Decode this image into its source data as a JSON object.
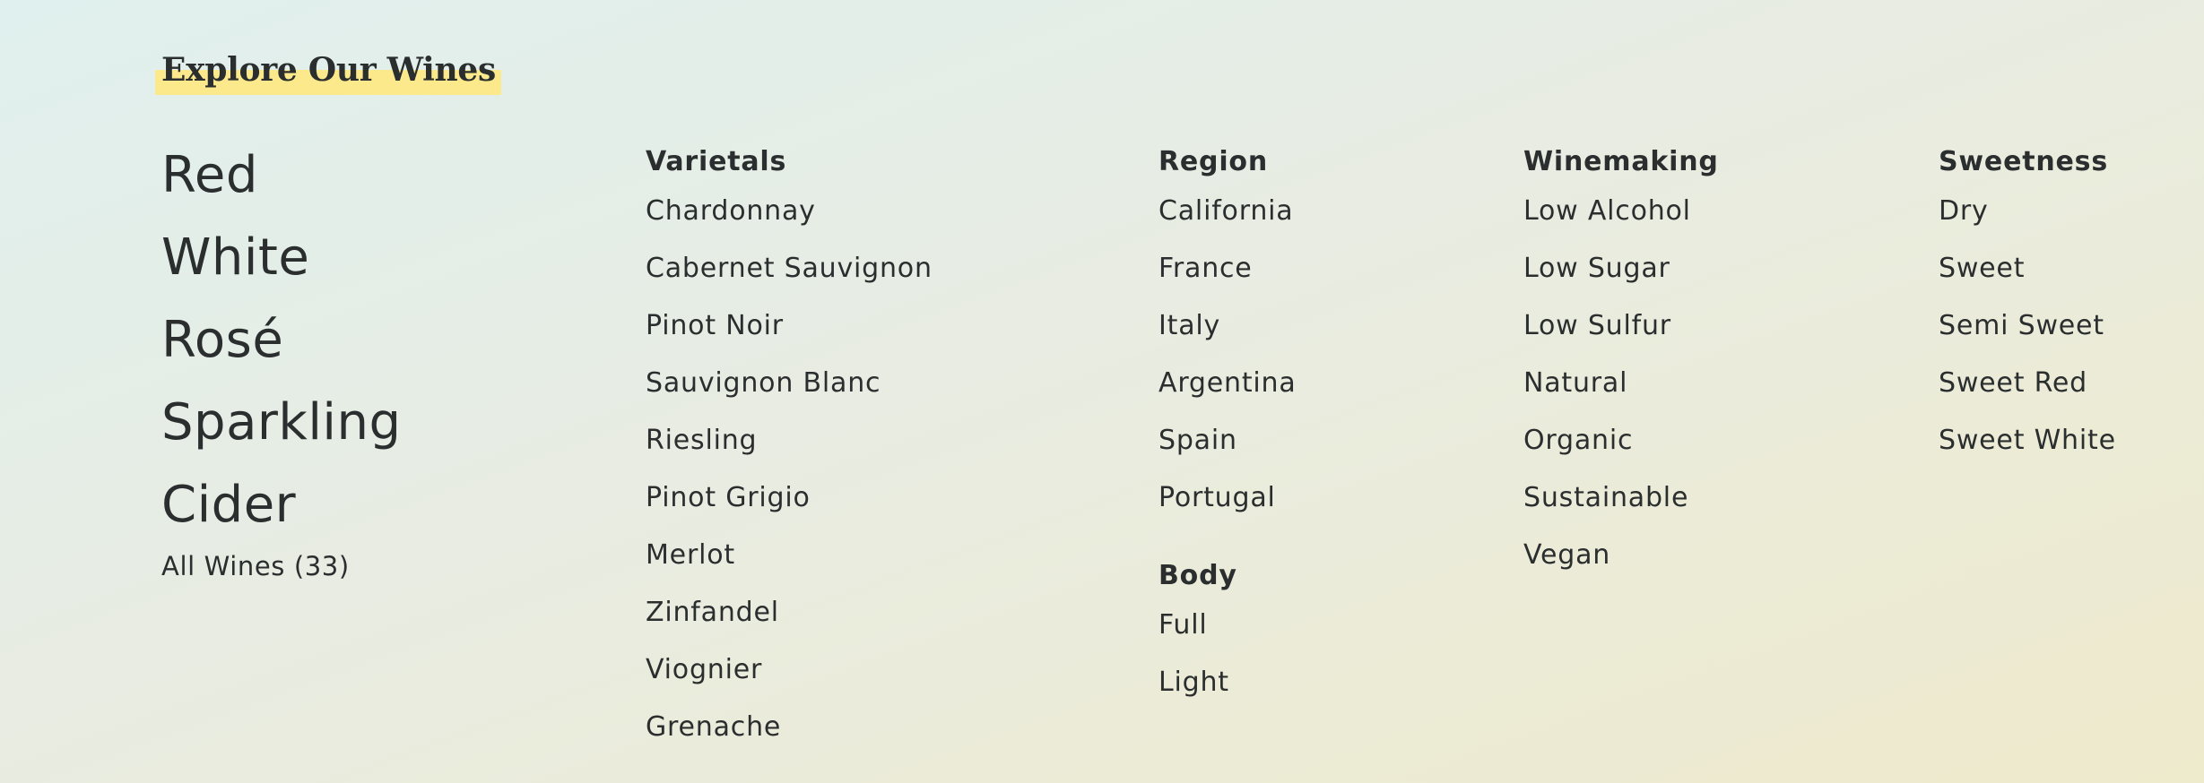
{
  "header": {
    "title": "Explore Our Wines"
  },
  "wine_types": {
    "items": [
      "Red",
      "White",
      "Rosé",
      "Sparkling",
      "Cider"
    ],
    "all_wines_label": "All Wines (33)"
  },
  "varietals": {
    "heading": "Varietals",
    "items": [
      "Chardonnay",
      "Cabernet Sauvignon",
      "Pinot Noir",
      "Sauvignon Blanc",
      "Riesling",
      "Pinot Grigio",
      "Merlot",
      "Zinfandel",
      "Viognier",
      "Grenache"
    ]
  },
  "region": {
    "heading": "Region",
    "items": [
      "California",
      "France",
      "Italy",
      "Argentina",
      "Spain",
      "Portugal"
    ]
  },
  "body": {
    "heading": "Body",
    "items": [
      "Full",
      "Light"
    ]
  },
  "winemaking": {
    "heading": "Winemaking",
    "items": [
      "Low Alcohol",
      "Low Sugar",
      "Low Sulfur",
      "Natural",
      "Organic",
      "Sustainable",
      "Vegan"
    ]
  },
  "sweetness": {
    "heading": "Sweetness",
    "items": [
      "Dry",
      "Sweet",
      "Semi Sweet",
      "Sweet Red",
      "Sweet White"
    ]
  }
}
